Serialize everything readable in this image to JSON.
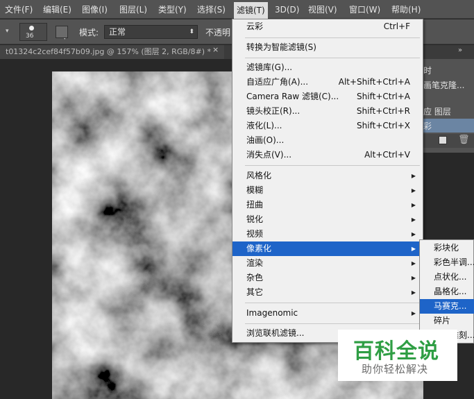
{
  "menubar": {
    "items": [
      "文件(F)",
      "编辑(E)",
      "图像(I)",
      "图层(L)",
      "类型(Y)",
      "选择(S)",
      "滤镜(T)",
      "3D(D)",
      "视图(V)",
      "窗口(W)",
      "帮助(H)"
    ],
    "active_index": 6
  },
  "options": {
    "brush_size": "36",
    "mode_label": "模式:",
    "mode_value": "正常",
    "opacity_label": "不透明"
  },
  "document_tab": {
    "title": "t01324c2cef84f57b09.jpg @ 157% (图层 2, RGB/8#) *",
    "close": "×"
  },
  "right_panel": {
    "items": [
      "时",
      "画笔克隆...",
      "应 图层",
      "彩"
    ]
  },
  "filter_menu": {
    "items": [
      {
        "label": "云彩",
        "shortcut": "Ctrl+F"
      },
      {
        "label": "转换为智能滤镜(S)",
        "shortcut": ""
      },
      {
        "label": "滤镜库(G)...",
        "shortcut": ""
      },
      {
        "label": "自适应广角(A)...",
        "shortcut": "Alt+Shift+Ctrl+A"
      },
      {
        "label": "Camera Raw 滤镜(C)...",
        "shortcut": "Shift+Ctrl+A"
      },
      {
        "label": "镜头校正(R)...",
        "shortcut": "Shift+Ctrl+R"
      },
      {
        "label": "液化(L)...",
        "shortcut": "Shift+Ctrl+X"
      },
      {
        "label": "油画(O)...",
        "shortcut": ""
      },
      {
        "label": "消失点(V)...",
        "shortcut": "Alt+Ctrl+V"
      },
      {
        "label": "风格化",
        "shortcut": ""
      },
      {
        "label": "模糊",
        "shortcut": ""
      },
      {
        "label": "扭曲",
        "shortcut": ""
      },
      {
        "label": "锐化",
        "shortcut": ""
      },
      {
        "label": "视频",
        "shortcut": ""
      },
      {
        "label": "像素化",
        "shortcut": ""
      },
      {
        "label": "渲染",
        "shortcut": ""
      },
      {
        "label": "杂色",
        "shortcut": ""
      },
      {
        "label": "其它",
        "shortcut": ""
      },
      {
        "label": "Imagenomic",
        "shortcut": ""
      },
      {
        "label": "浏览联机滤镜...",
        "shortcut": ""
      }
    ],
    "highlighted": "像素化"
  },
  "pixelate_submenu": {
    "items": [
      "彩块化",
      "彩色半调...",
      "点状化...",
      "晶格化...",
      "马赛克...",
      "碎片",
      "铜版雕刻..."
    ],
    "highlighted": "马赛克..."
  },
  "watermark": {
    "title": "百科全说",
    "subtitle": "助你轻松解决"
  },
  "colors": {
    "menu_highlight": "#1e64c8",
    "ui_dark": "#535353",
    "watermark_green": "#2f9e44"
  }
}
